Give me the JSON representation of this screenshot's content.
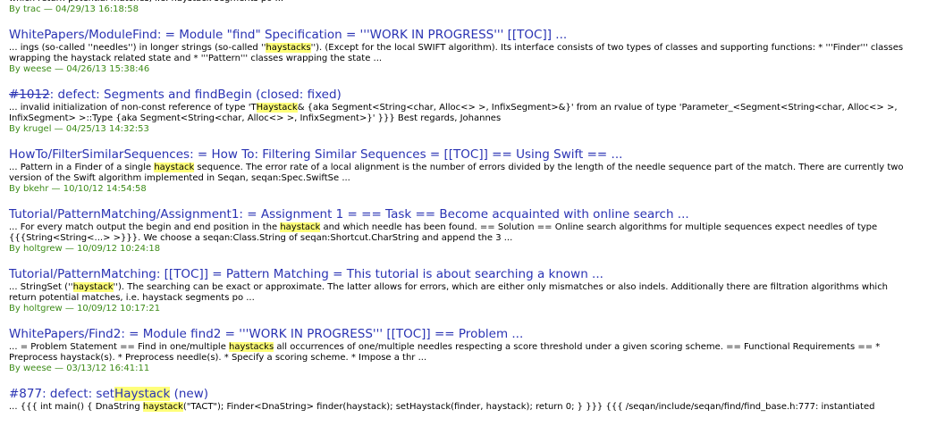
{
  "results": [
    {
      "title": null,
      "excerpt": [
        {
          "t": "which return potential matches, i.e. haystack segments po ..."
        }
      ],
      "author": "trac",
      "date": "04/29/13 16:18:58"
    },
    {
      "title": [
        {
          "t": "WhitePapers/ModuleFind: = Module \"find\" Specification = '''WORK IN PROGRESS''' [[TOC]] ..."
        }
      ],
      "excerpt": [
        {
          "t": "... ings (so-called ''needles'') in longer strings (so-called ''"
        },
        {
          "t": "haystacks",
          "hl": true
        },
        {
          "t": "''). (Except for the local SWIFT algorithm). Its interface consists of two types of classes and supporting functions: * '''Finder''' classes wrapping the haystack related state and * '''Pattern''' classes wrapping the state ..."
        }
      ],
      "author": "weese",
      "date": "04/26/13 15:38:46"
    },
    {
      "title": [
        {
          "t": "#1012",
          "closed": true
        },
        {
          "t": ": defect: Segments and findBegin (closed: fixed)"
        }
      ],
      "excerpt": [
        {
          "t": "... invalid initialization of non-const reference of type 'T"
        },
        {
          "t": "Haystack",
          "hl": true
        },
        {
          "t": "& {aka Segment<String<char, Alloc<> >, InfixSegment>&}' from an rvalue of type 'Parameter_<Segment<String<char, Alloc<> >, InfixSegment> >::Type {aka Segment<String<char, Alloc<> >, InfixSegment>}' }}} Best regards, Johannes"
        }
      ],
      "author": "krugel",
      "date": "04/25/13 14:32:53"
    },
    {
      "title": [
        {
          "t": "HowTo/FilterSimilarSequences: = How To: Filtering Similar Sequences = [[TOC]] == Using Swift == ..."
        }
      ],
      "excerpt": [
        {
          "t": "... Pattern in a Finder of a single "
        },
        {
          "t": "haystack",
          "hl": true
        },
        {
          "t": " sequence. The error rate of a local alignment is the number of errors divided by the length of the needle sequence part of the match. There are currently two version of the Swift algorithm implemented in Seqan, seqan:Spec.SwiftSe ..."
        }
      ],
      "author": "bkehr",
      "date": "10/10/12 14:54:58"
    },
    {
      "title": [
        {
          "t": "Tutorial/PatternMatching/Assignment1: = Assignment 1 = == Task == Become acquainted with online search ..."
        }
      ],
      "excerpt": [
        {
          "t": "... For every match output the begin and end position in the "
        },
        {
          "t": "haystack",
          "hl": true
        },
        {
          "t": " and which needle has been found. == Solution == Online search algorithms for multiple sequences expect needles of type {{{String<String<...> >}}}. We choose a seqan:Class.String of seqan:Shortcut.CharString and append the 3 ..."
        }
      ],
      "author": "holtgrew",
      "date": "10/09/12 10:24:18"
    },
    {
      "title": [
        {
          "t": "Tutorial/PatternMatching: [[TOC]] = Pattern Matching = This tutorial is about searching a known ..."
        }
      ],
      "excerpt": [
        {
          "t": "... StringSet (''"
        },
        {
          "t": "haystack",
          "hl": true
        },
        {
          "t": "''). The searching can be exact or approximate. The latter allows for errors, which are either only mismatches or also indels. Additionally there are filtration algorithms which return potential matches, i.e. haystack segments po ..."
        }
      ],
      "author": "holtgrew",
      "date": "10/09/12 10:17:21"
    },
    {
      "title": [
        {
          "t": "WhitePapers/Find2: = Module find2 = '''WORK IN PROGRESS''' [[TOC]] == Problem ..."
        }
      ],
      "excerpt": [
        {
          "t": "... = Problem Statement == Find in one/multiple "
        },
        {
          "t": "haystacks",
          "hl": true
        },
        {
          "t": " all occurrences of one/multiple needles respecting a score threshold under a given scoring scheme. == Functional Requirements == * Preprocess haystack(s). * Preprocess needle(s). * Specify a scoring scheme. * Impose a thr ..."
        }
      ],
      "author": "weese",
      "date": "03/13/12 16:41:11"
    },
    {
      "title": [
        {
          "t": "#877: defect: set"
        },
        {
          "t": "Haystack",
          "hl": true
        },
        {
          "t": " (new)"
        }
      ],
      "excerpt": [
        {
          "t": "... {{{ int main() { DnaString "
        },
        {
          "t": "haystack",
          "hl": true
        },
        {
          "t": "(\"TACT\"); Finder<DnaString> finder(haystack); setHaystack(finder, haystack); return 0; } }}} {{{ /seqan/include/seqan/find/find_base.h:777: instantiated"
        }
      ],
      "author": null,
      "date": null
    }
  ],
  "meta_separator": "—"
}
